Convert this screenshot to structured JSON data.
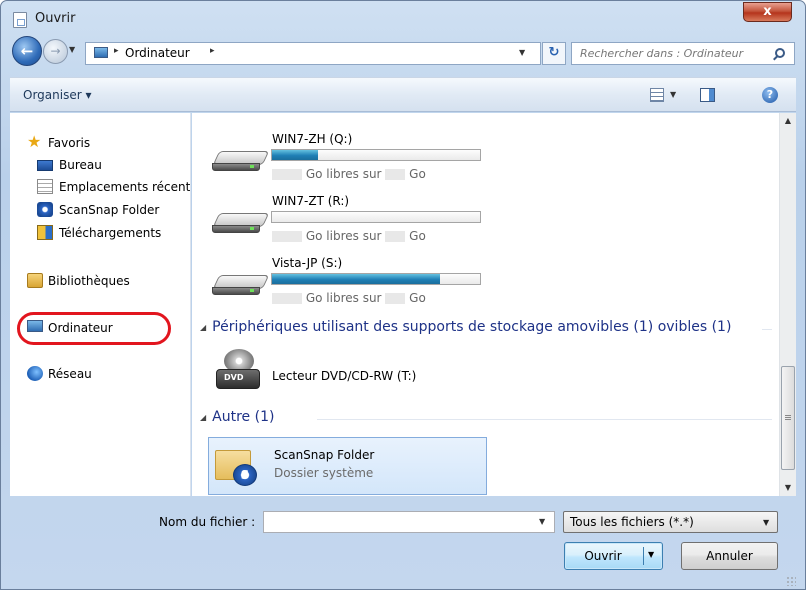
{
  "window": {
    "title": "Ouvrir",
    "close_label": "x"
  },
  "nav": {
    "back_glyph": "←",
    "forward_glyph": "→"
  },
  "address": {
    "path": "Ordinateur",
    "separator": "▸"
  },
  "search": {
    "placeholder": "Rechercher dans : Ordinateur"
  },
  "toolbar": {
    "organise_label": "Organiser ▾",
    "help_glyph": "?"
  },
  "sidebar": {
    "favorites": "Favoris",
    "items": [
      {
        "label": "Bureau",
        "icon": "desktop-icon"
      },
      {
        "label": "Emplacements récents",
        "icon": "recent-places-icon"
      },
      {
        "label": "ScanSnap Folder",
        "icon": "scansnap-icon"
      },
      {
        "label": "Téléchargements",
        "icon": "downloads-icon"
      }
    ],
    "libraries": "Bibliothèques",
    "computer": "Ordinateur",
    "network": "Réseau"
  },
  "drives": [
    {
      "name": "WIN7-ZH (Q:)",
      "used_fraction": 0.22,
      "free_prefix": "Go libres sur",
      "unit": "Go"
    },
    {
      "name": "WIN7-ZT (R:)",
      "used_fraction": 0.0,
      "free_prefix": "Go libres sur",
      "unit": "Go"
    },
    {
      "name": "Vista-JP (S:)",
      "used_fraction": 0.81,
      "free_prefix": "Go libres sur",
      "unit": "Go"
    }
  ],
  "sections": {
    "removable": "Périphériques utilisant des supports de stockage amovibles (1) ovibles (1)",
    "other": "Autre (1)"
  },
  "dvd": {
    "name": "Lecteur DVD/CD-RW (T:)",
    "badge": "DVD"
  },
  "folder_tile": {
    "title": "ScanSnap Folder",
    "subtitle": "Dossier système",
    "logo": "S"
  },
  "footer": {
    "filename_label": "Nom du fichier :",
    "filename_value": "",
    "filter_value": "Tous les fichiers (*.*)",
    "open_label": "Ouvrir",
    "cancel_label": "Annuler"
  },
  "colors": {
    "highlight_ring": "#e2151e",
    "bar_fill": "#1f7fb5",
    "section_text": "#1e3287"
  }
}
